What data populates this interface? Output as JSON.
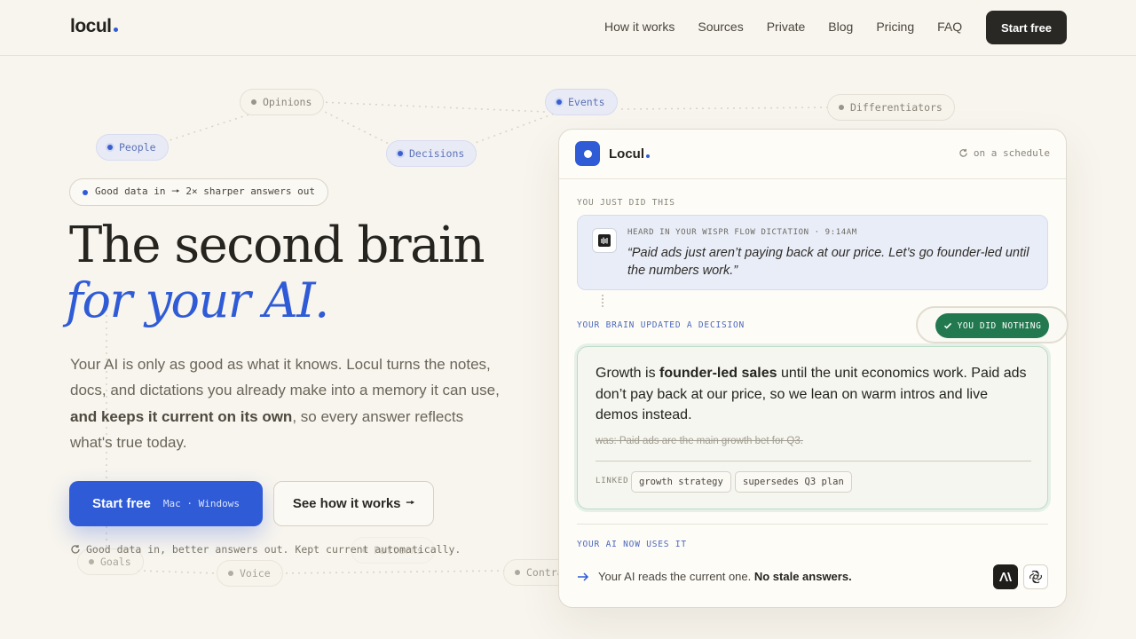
{
  "header": {
    "logo": "locul",
    "nav": [
      "How it works",
      "Sources",
      "Private",
      "Blog",
      "Pricing",
      "FAQ"
    ],
    "cta": "Start free"
  },
  "graph": {
    "nodes": [
      "Opinions",
      "Events",
      "Differentiators",
      "People",
      "Decisions",
      "Goals",
      "Voice",
      "Contra",
      "Patterns"
    ]
  },
  "hero": {
    "pill": "Good data in 🠖 2× sharper answers out",
    "title_line1": "The second brain",
    "title_line2": "for your AI.",
    "lead_start": "Your AI is only as good as what it knows. Locul turns the notes, docs, and dictations you already make into a memory it can use, ",
    "lead_bold": "and keeps it current on its own",
    "lead_end": ", so every answer reflects what's true today.",
    "primary_label": "Start free",
    "primary_sub": "Mac · Windows",
    "secondary_label": "See how it works",
    "secondary_arrow": "🠖",
    "footnote": "Good data in, better answers out. Kept current automatically."
  },
  "card": {
    "title": "Locul",
    "schedule": "on a schedule",
    "section1": "YOU JUST DID THIS",
    "dictation_meta": "HEARD IN YOUR WISPR FLOW DICTATION · 9:14AM",
    "dictation_quote": "“Paid ads just aren’t paying back at our price. Let’s go founder-led until the numbers work.”",
    "section2": "YOUR BRAIN UPDATED A DECISION",
    "did_nothing": "YOU DID NOTHING",
    "decision_pre": "Growth is ",
    "decision_bold": "founder-led sales",
    "decision_post": " until the unit economics work. Paid ads don’t pay back at our price, so we lean on warm intros and live demos instead.",
    "was": "was: Paid ads are the main growth bet for Q3.",
    "linked_label": "LINKED",
    "tags": [
      "growth strategy",
      "supersedes Q3 plan"
    ],
    "section3": "YOUR AI NOW USES IT",
    "uses_text": "Your AI reads the current one. ",
    "uses_bold": "No stale answers.",
    "ai_icons": [
      "anthropic-icon",
      "openai-icon"
    ]
  },
  "colors": {
    "accent": "#2f5bd6",
    "success": "#23794f",
    "background": "#f8f5ee",
    "ink": "#2a2824"
  }
}
